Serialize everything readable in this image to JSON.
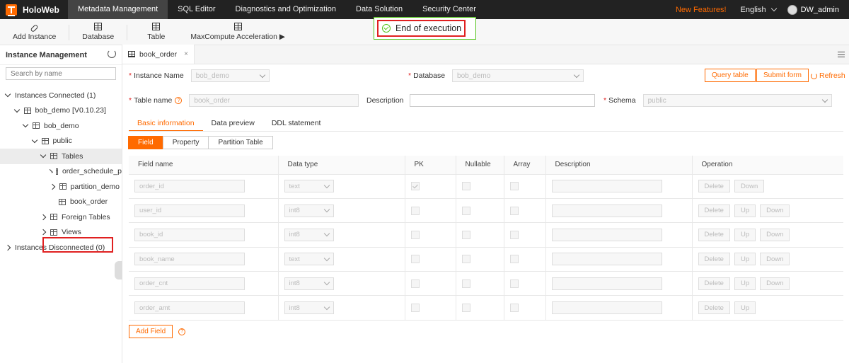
{
  "app": {
    "title": "HoloWeb"
  },
  "nav": {
    "items": [
      "Metadata Management",
      "SQL Editor",
      "Diagnostics and Optimization",
      "Data Solution",
      "Security Center"
    ],
    "active": "Metadata Management",
    "new_features": "New Features!",
    "language": "English",
    "user": "DW_admin"
  },
  "toolbar": {
    "add_instance": "Add Instance",
    "database": "Database",
    "table": "Table",
    "maxcompute": "MaxCompute Acceleration ▶"
  },
  "toast": {
    "message": "End of execution"
  },
  "sidebar": {
    "title": "Instance Management",
    "search_placeholder": "Search by name",
    "tree": [
      {
        "label": "Instances Connected (1)",
        "indent": 0,
        "chevron": "down",
        "icon": ""
      },
      {
        "label": "bob_demo [V0.10.23]",
        "indent": 1,
        "chevron": "down",
        "icon": "instance-icon"
      },
      {
        "label": "bob_demo",
        "indent": 2,
        "chevron": "down",
        "icon": "database-icon"
      },
      {
        "label": "public",
        "indent": 3,
        "chevron": "down",
        "icon": "schema-icon"
      },
      {
        "label": "Tables",
        "indent": 4,
        "chevron": "down",
        "icon": "table-folder-icon",
        "selected": true
      },
      {
        "label": "order_schedule_p",
        "indent": 5,
        "chevron": "right",
        "icon": "table-icon"
      },
      {
        "label": "partition_demo",
        "indent": 5,
        "chevron": "right",
        "icon": "table-icon"
      },
      {
        "label": "book_order",
        "indent": 6,
        "chevron": "",
        "icon": "table-icon"
      },
      {
        "label": "Foreign Tables",
        "indent": 4,
        "chevron": "right",
        "icon": "foreign-table-icon"
      },
      {
        "label": "Views",
        "indent": 4,
        "chevron": "right",
        "icon": "view-icon"
      },
      {
        "label": "Instances Disconnected (0)",
        "indent": 0,
        "chevron": "right",
        "icon": ""
      }
    ]
  },
  "editor_tab": {
    "label": "book_order",
    "close": "×"
  },
  "form": {
    "instance_label": "Instance Name",
    "instance_value": "bob_demo",
    "database_label": "Database",
    "database_value": "bob_demo",
    "table_label": "Table name",
    "table_value": "book_order",
    "description_label": "Description",
    "schema_label": "Schema",
    "schema_value": "public",
    "query_table": "Query table",
    "submit_form": "Submit form",
    "refresh": "Refresh"
  },
  "subtabs": [
    "Basic information",
    "Data preview",
    "DDL statement"
  ],
  "segments": [
    "Field",
    "Property",
    "Partition Table"
  ],
  "table": {
    "headers": [
      "Field name",
      "Data type",
      "PK",
      "Nullable",
      "Array",
      "Description",
      "Operation"
    ],
    "rows": [
      {
        "name": "order_id",
        "type": "text",
        "pk": true,
        "ops": [
          "Delete",
          "Down"
        ]
      },
      {
        "name": "user_id",
        "type": "int8",
        "pk": false,
        "ops": [
          "Delete",
          "Up",
          "Down"
        ]
      },
      {
        "name": "book_id",
        "type": "int8",
        "pk": false,
        "ops": [
          "Delete",
          "Up",
          "Down"
        ]
      },
      {
        "name": "book_name",
        "type": "text",
        "pk": false,
        "ops": [
          "Delete",
          "Up",
          "Down"
        ]
      },
      {
        "name": "order_cnt",
        "type": "int8",
        "pk": false,
        "ops": [
          "Delete",
          "Up",
          "Down"
        ]
      },
      {
        "name": "order_amt",
        "type": "int8",
        "pk": false,
        "ops": [
          "Delete",
          "Up"
        ]
      }
    ]
  },
  "add_field": "Add Field"
}
